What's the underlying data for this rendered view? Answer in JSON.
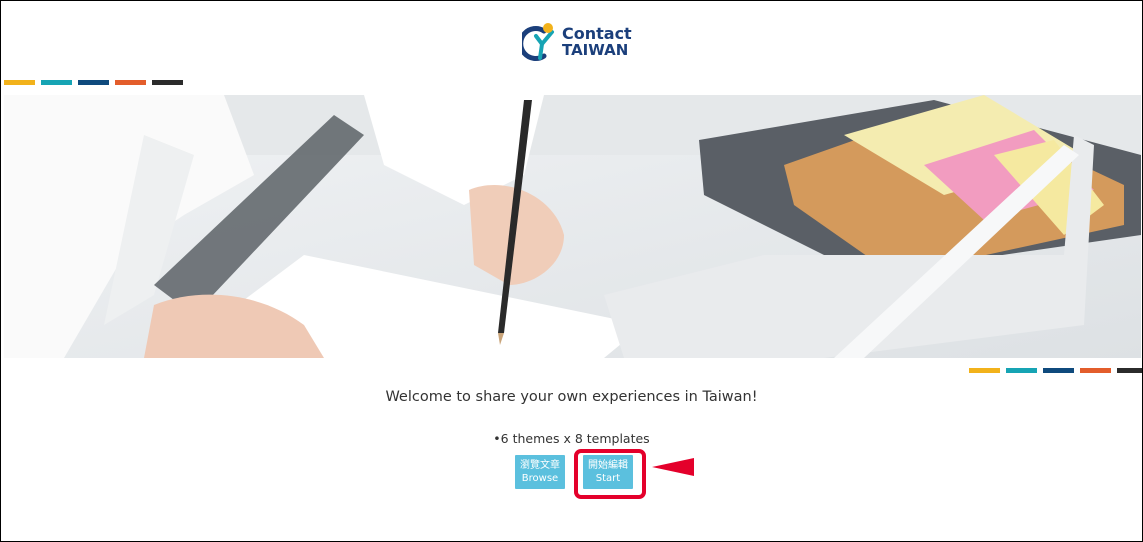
{
  "header": {
    "logo_line1": "Contact",
    "logo_line2": "TAIWAN"
  },
  "stripe_colors": [
    "#f2b21b",
    "#16a4b4",
    "#0f4a7d",
    "#e35d2b",
    "#2b2b2b"
  ],
  "main": {
    "welcome_text": "Welcome to share your own experiences in Taiwan!",
    "bullet_text": "•6 themes x 8 templates",
    "browse_button": {
      "label_zh": "瀏覽文章",
      "label_en": "Browse"
    },
    "start_button": {
      "label_zh": "開始編輯",
      "label_en": "Start"
    }
  },
  "annotation": {
    "color": "#e4002b"
  }
}
